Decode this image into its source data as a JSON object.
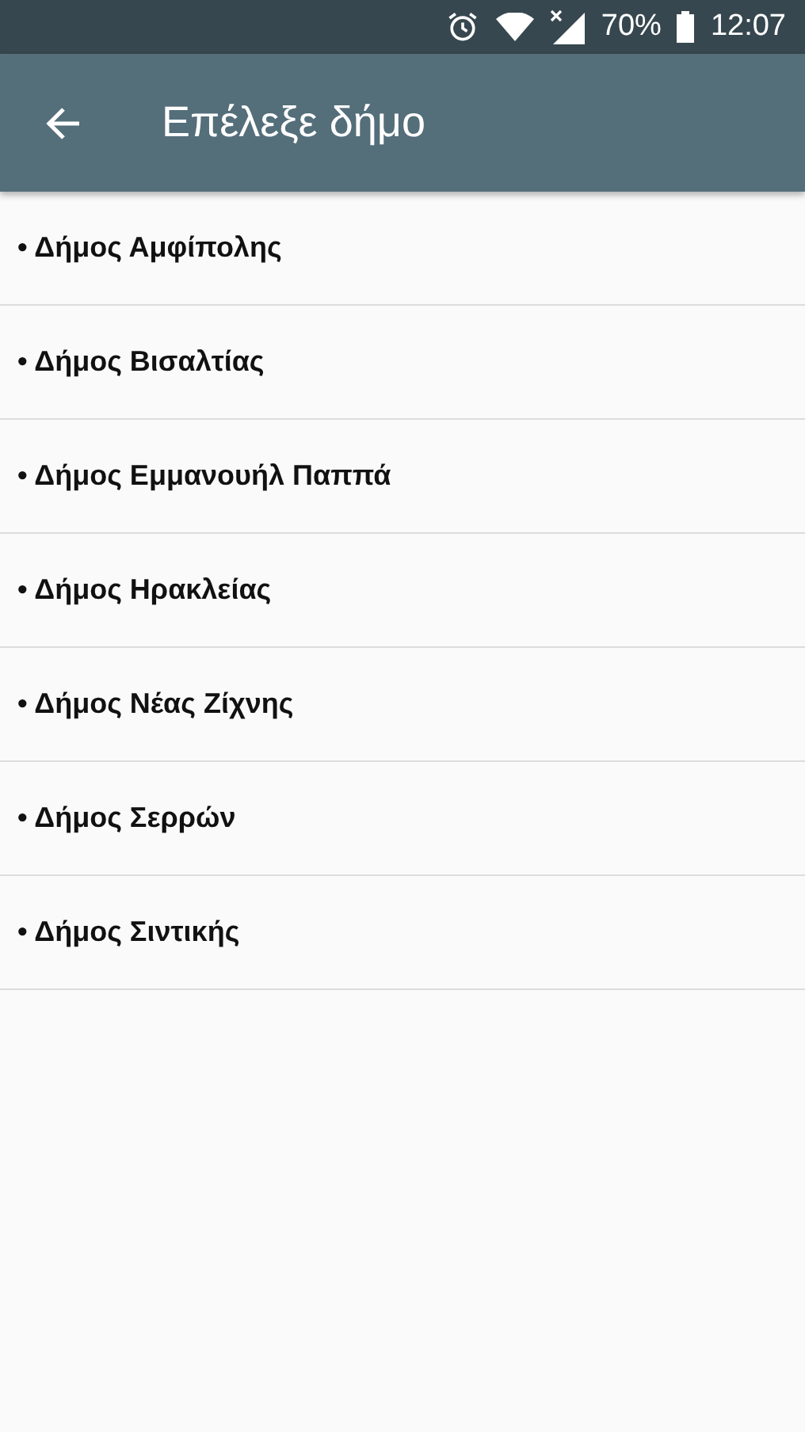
{
  "status_bar": {
    "battery": "70%",
    "time": "12:07"
  },
  "app_bar": {
    "title": "Επέλεξε δήμο"
  },
  "items": [
    {
      "label": "• Δήμος Αμφίπολης"
    },
    {
      "label": "• Δήμος Βισαλτίας"
    },
    {
      "label": "• Δήμος Εμμανουήλ Παππά"
    },
    {
      "label": "• Δήμος Ηρακλείας"
    },
    {
      "label": "• Δήμος Νέας Ζίχνης"
    },
    {
      "label": "• Δήμος Σερρών"
    },
    {
      "label": "• Δήμος Σιντικής"
    }
  ]
}
